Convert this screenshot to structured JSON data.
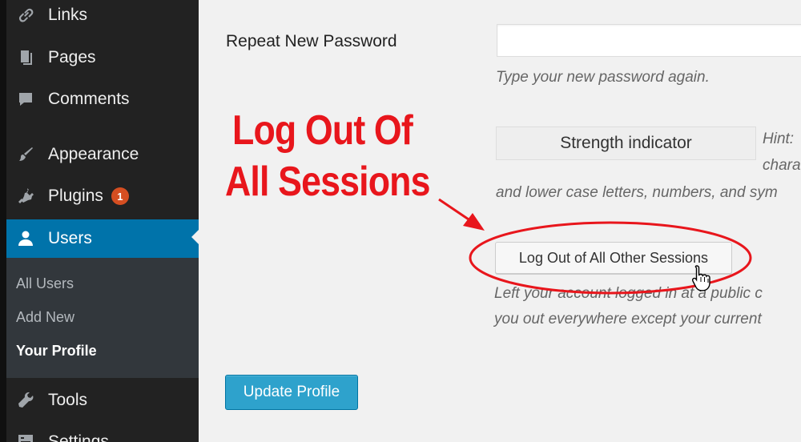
{
  "sidebar": {
    "items": [
      {
        "label": "Links",
        "icon": "link-icon"
      },
      {
        "label": "Pages",
        "icon": "pages-icon"
      },
      {
        "label": "Comments",
        "icon": "comment-icon"
      },
      {
        "label": "Appearance",
        "icon": "paintbrush-icon"
      },
      {
        "label": "Plugins",
        "icon": "plugin-icon",
        "badge": "1"
      },
      {
        "label": "Users",
        "icon": "user-icon",
        "active": true
      },
      {
        "label": "Tools",
        "icon": "wrench-icon"
      },
      {
        "label": "Settings",
        "icon": "settings-icon"
      }
    ],
    "submenu": [
      {
        "label": "All Users"
      },
      {
        "label": "Add New"
      },
      {
        "label": "Your Profile",
        "current": true
      }
    ]
  },
  "form": {
    "repeat_password_label": "Repeat New Password",
    "repeat_password_value": "",
    "repeat_password_hint": "Type your new password again.",
    "strength_indicator": "Strength indicator",
    "hint_line1": "Hint:",
    "hint_line2": "chara",
    "hint_line3": "and lower case letters, numbers, and sym",
    "logout_button": "Log Out of All Other Sessions",
    "logout_desc_line1": "Left your account logged in at a public c",
    "logout_desc_line2": "you out everywhere except your current",
    "update_button": "Update Profile"
  },
  "annotation": {
    "line1": "Log Out Of",
    "line2": "All Sessions",
    "color": "#e8161c"
  },
  "colors": {
    "sidebar_bg": "#222222",
    "active_bg": "#0073aa",
    "submenu_bg": "#32373c",
    "badge_bg": "#d54e21",
    "primary_button": "#2ea2cc"
  }
}
